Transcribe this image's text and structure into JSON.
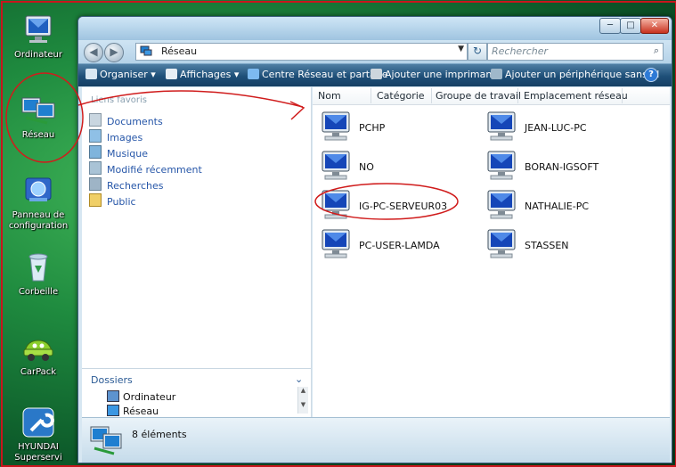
{
  "desktop": {
    "icons": [
      {
        "label": "Ordinateur",
        "icon": "computer-icon"
      },
      {
        "label": "Réseau",
        "icon": "network-icon"
      },
      {
        "label": "Panneau de configuration",
        "icon": "control-panel-icon"
      },
      {
        "label": "Corbeille",
        "icon": "recycle-bin-icon"
      },
      {
        "label": "CarPack",
        "icon": "car-icon"
      },
      {
        "label": "HYUNDAI Superservi",
        "icon": "wrench-icon"
      }
    ]
  },
  "window": {
    "address": "Réseau",
    "search_placeholder": "Rechercher",
    "caption": {
      "minimize": "─",
      "maximize": "□",
      "close": "✕"
    },
    "toolbar": {
      "organize": "Organiser",
      "views": "Affichages",
      "network_center": "Centre Réseau et partage",
      "add_printer": "Ajouter une imprimante",
      "add_wireless": "Ajouter un périphérique sans fil",
      "help": "?"
    },
    "nav": {
      "favorites_header": "Liens favoris",
      "favorites": [
        "Documents",
        "Images",
        "Musique",
        "Modifié récemment",
        "Recherches",
        "Public"
      ],
      "folders_title": "Dossiers",
      "tree": [
        "Ordinateur",
        "Réseau"
      ]
    },
    "columns": [
      "Nom",
      "Catégorie",
      "Groupe de travail",
      "Emplacement réseau"
    ],
    "items": [
      "PCHP",
      "JEAN-LUC-PC",
      "NO",
      "BORAN-IGSOFT",
      "IG-PC-SERVEUR03",
      "NATHALIE-PC",
      "PC-USER-LAMDA",
      "STASSEN"
    ],
    "status": {
      "count": "8 éléments"
    }
  }
}
